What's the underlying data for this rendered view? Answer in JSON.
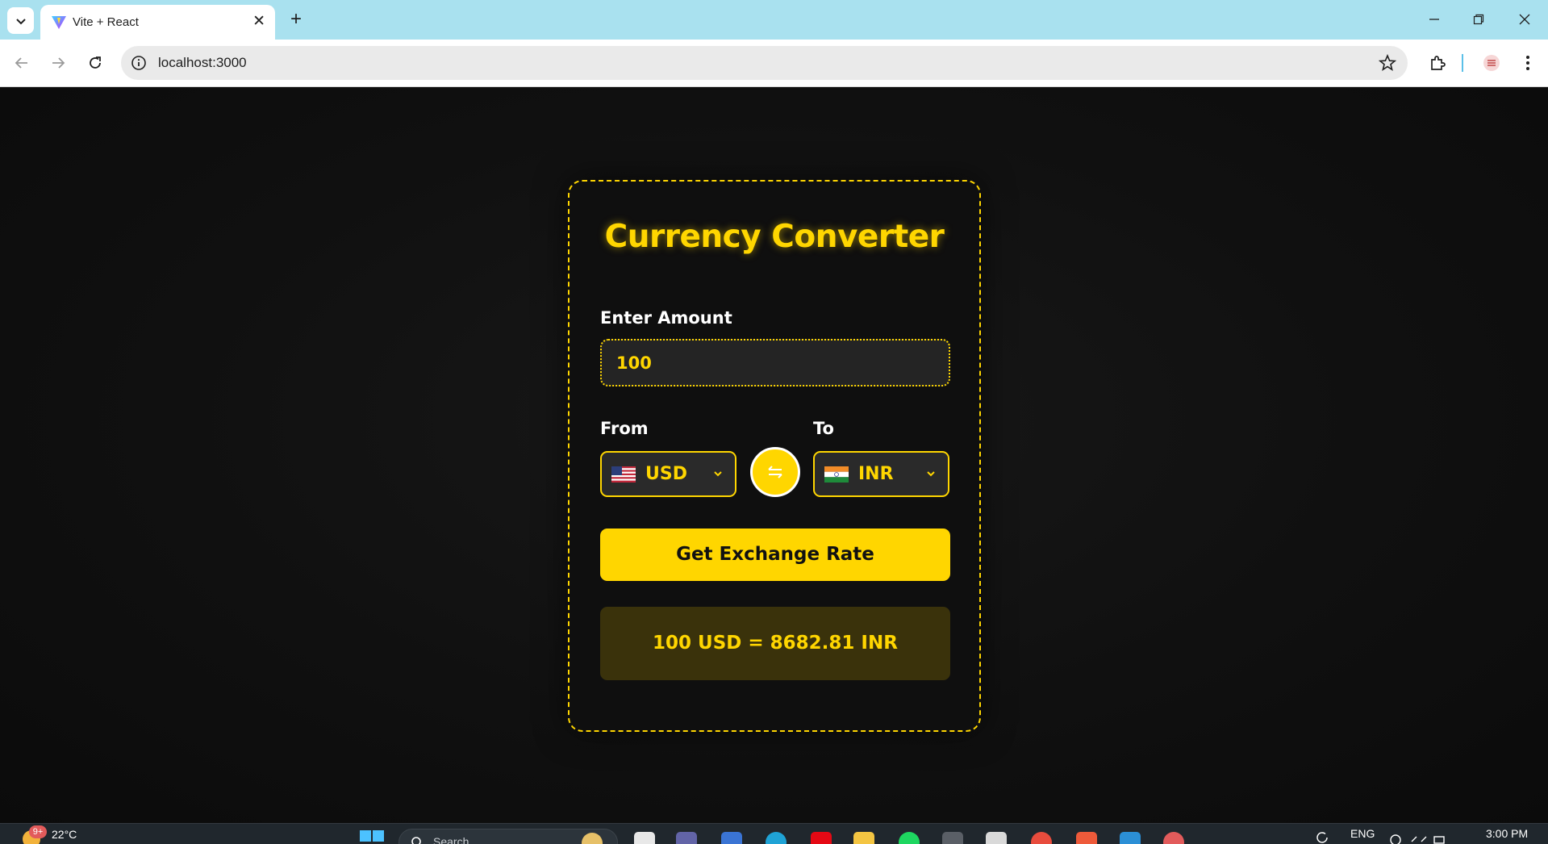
{
  "browser": {
    "tab_title": "Vite + React",
    "tab_close": "✕",
    "new_tab": "+",
    "url": "localhost:3000"
  },
  "app": {
    "title": "Currency Converter",
    "amount_label": "Enter Amount",
    "amount_value": "100",
    "from_label": "From",
    "to_label": "To",
    "from_currency": "USD",
    "to_currency": "INR",
    "button_label": "Get Exchange Rate",
    "result": "100 USD = 8682.81 INR",
    "accent_color": "#ffd600"
  },
  "taskbar": {
    "weather_badge": "9+",
    "temperature": "22°C",
    "search_placeholder": "Search",
    "language": "ENG",
    "time": "3:00 PM"
  }
}
